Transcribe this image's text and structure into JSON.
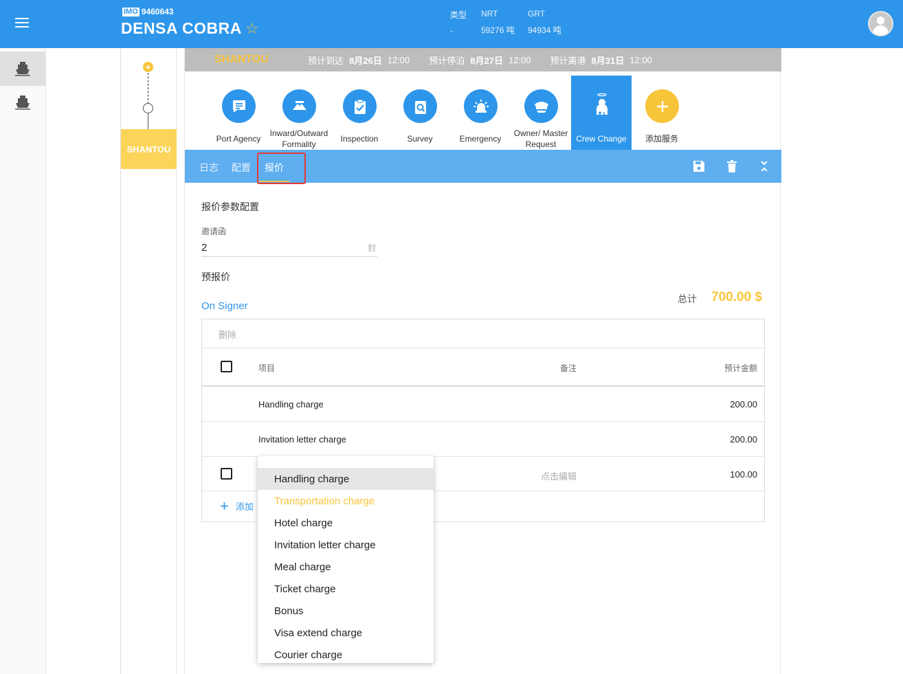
{
  "header": {
    "imo_label": "IMO",
    "imo_number": "9460643",
    "ship_name": "DENSA COBRA",
    "star": "☆",
    "type_label": "类型",
    "type_value": "-",
    "nrt_label": "NRT",
    "nrt_value": "59276 吨",
    "grt_label": "GRT",
    "grt_value": "94934 吨"
  },
  "timeline": {
    "plus": "+",
    "port": "SHANTOU"
  },
  "portbar": {
    "port": "SHANTOU",
    "eta_label": "预计到达",
    "eta_date": "8月26日",
    "eta_time": "12:00",
    "etb_label": "预计停泊",
    "etb_date": "8月27日",
    "etb_time": "12:00",
    "etd_label": "预计离港",
    "etd_date": "8月31日",
    "etd_time": "12:00"
  },
  "services": [
    {
      "label": "Port Agency"
    },
    {
      "label": "Inward/Outward Formality"
    },
    {
      "label": "Inspection"
    },
    {
      "label": "Survey"
    },
    {
      "label": "Emergency"
    },
    {
      "label": "Owner/ Master Request"
    },
    {
      "label": "Crew Change"
    },
    {
      "label": "添加服务"
    }
  ],
  "tabs": {
    "log": "日志",
    "config": "配置",
    "quote": "报价"
  },
  "quote_config": {
    "title": "报价参数配置",
    "field_label": "邀请函",
    "field_value": "2",
    "field_unit": "封"
  },
  "pre_quote": {
    "title": "预报价",
    "total_label": "总计",
    "total_value": "700.00 $",
    "subsection": "On Signer"
  },
  "table": {
    "delete_label": "删除",
    "headers": {
      "item": "项目",
      "note": "备注",
      "amount": "预计金额"
    },
    "rows": [
      {
        "item": "Handling charge",
        "note": "",
        "amount": "200.00"
      },
      {
        "item": "Invitation letter charge",
        "note": "",
        "amount": "200.00"
      },
      {
        "item": "",
        "note": "点击编辑",
        "amount": "100.00"
      }
    ],
    "add_label": "添加"
  },
  "dropdown": {
    "options": [
      "Handling charge",
      "Transportation charge",
      "Hotel charge",
      "Invitation letter charge",
      "Meal charge",
      "Ticket charge",
      "Bonus",
      "Visa extend charge",
      "Courier charge"
    ],
    "hovered_index": 0,
    "selected_index": 1
  },
  "colors": {
    "primary": "#2e96ea",
    "accent": "#f8c43a",
    "tabbar": "#5eaef0",
    "highlight": "#e53935"
  }
}
